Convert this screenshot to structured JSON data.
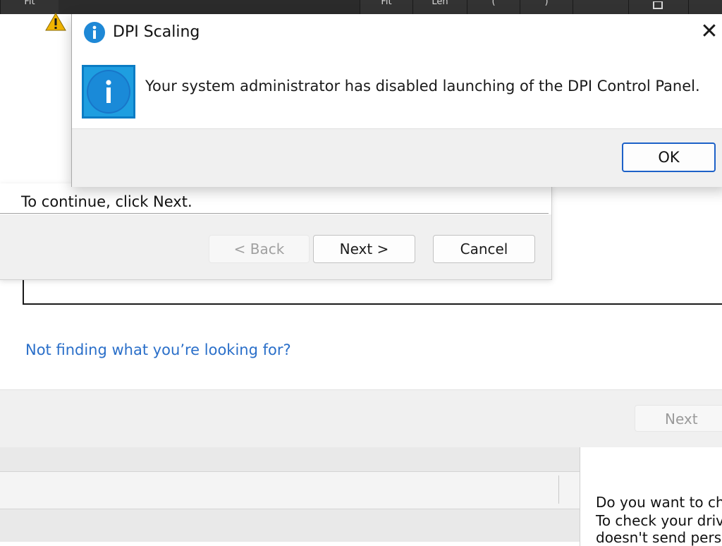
{
  "taskbar": {
    "buttons": [
      "Fit",
      "Fit",
      "Len",
      "(",
      ")",
      "",
      ""
    ]
  },
  "background_wizard": {
    "help_link": "Not finding what you’re looking for?",
    "next_label": "Next"
  },
  "driver_panel": {
    "line1": "Do you want to ch",
    "line2": "To check your driv",
    "line3": "doesn't send pers"
  },
  "wizard": {
    "continue_text": "To continue, click Next.",
    "back_label": "< Back",
    "next_label": "Next >",
    "cancel_label": "Cancel"
  },
  "dpi_dialog": {
    "title": "DPI Scaling",
    "message": "Your system administrator has disabled launching of the DPI Control Panel.",
    "ok_label": "OK",
    "close_glyph": "✕"
  },
  "colors": {
    "link": "#2a6fc9",
    "info_blue": "#1e9ee0",
    "ok_border": "#1d61c8",
    "warning": "#f0b400"
  },
  "icons": {
    "title_icon": "info-icon",
    "message_icon": "info-icon",
    "background_icon": "warning-icon",
    "close": "close-icon"
  }
}
